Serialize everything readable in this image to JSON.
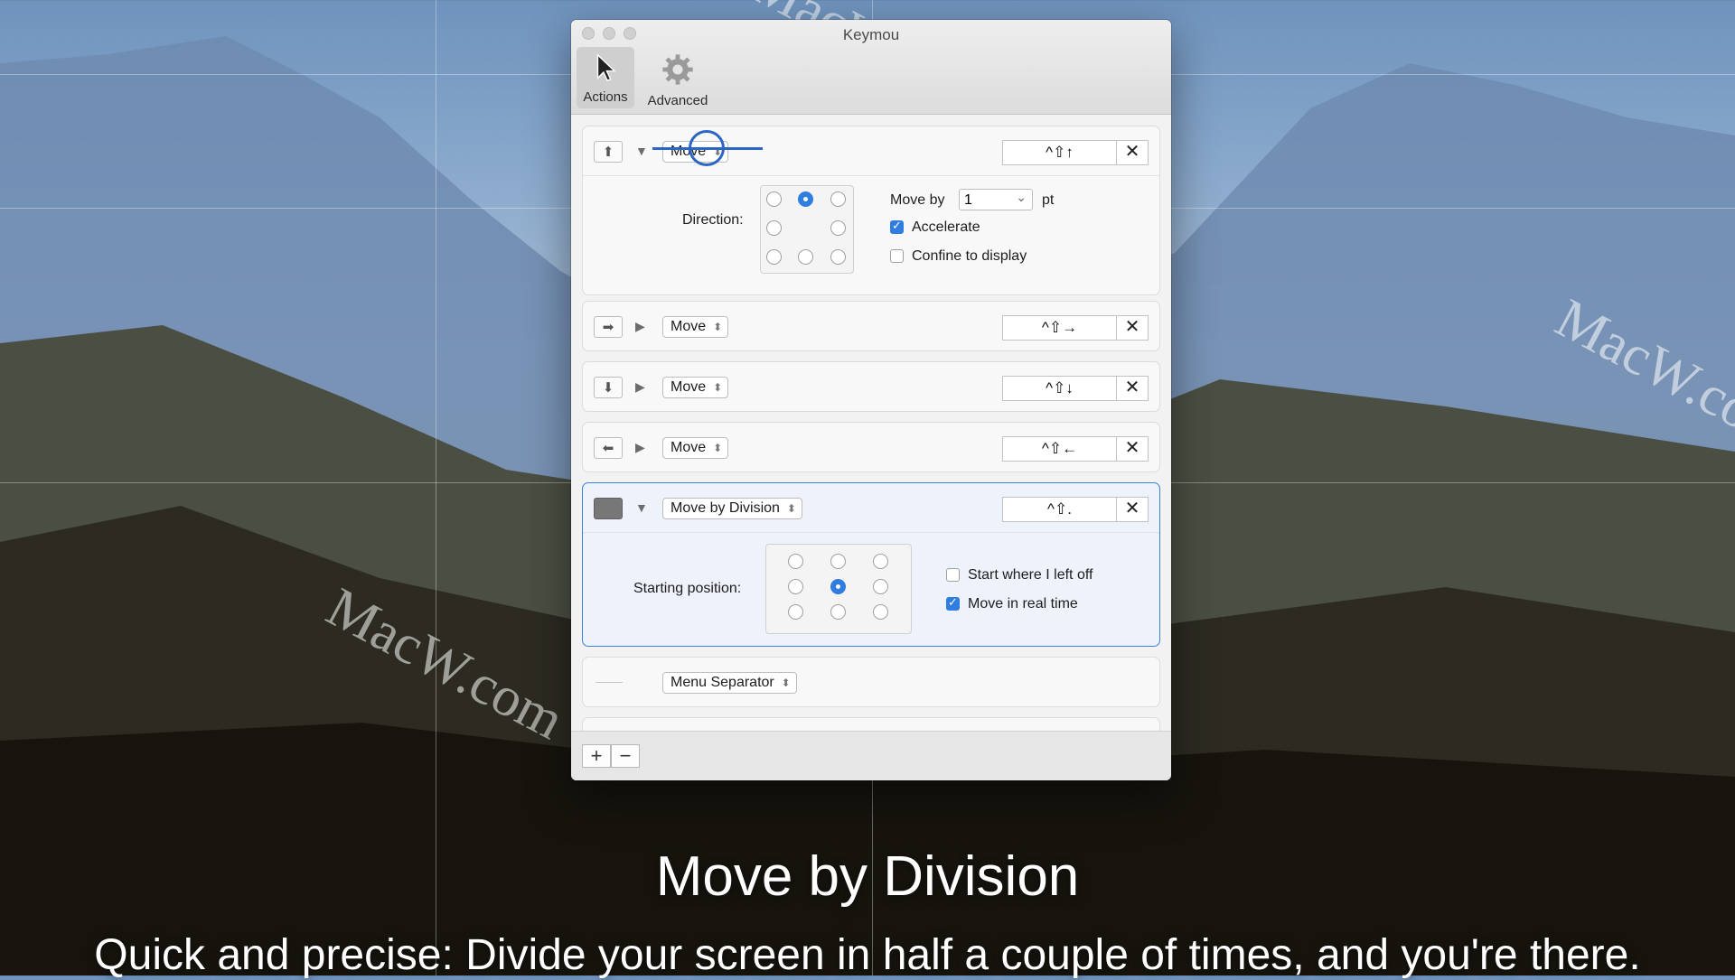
{
  "window": {
    "title": "Keymou",
    "toolbar": [
      {
        "label": "Actions",
        "icon": "cursor-arrow-icon",
        "active": true
      },
      {
        "label": "Advanced",
        "icon": "gear-icon",
        "active": false
      }
    ]
  },
  "rows": [
    {
      "icon": "arrow-up-icon",
      "action": "Move",
      "shortcut": "^⇧↑",
      "expanded": true
    },
    {
      "icon": "arrow-right-icon",
      "action": "Move",
      "shortcut": "^⇧→",
      "expanded": false
    },
    {
      "icon": "arrow-down-icon",
      "action": "Move",
      "shortcut": "^⇧↓",
      "expanded": false
    },
    {
      "icon": "arrow-left-icon",
      "action": "Move",
      "shortcut": "^⇧←",
      "expanded": false
    },
    {
      "icon": "division-icon",
      "action": "Move by Division",
      "shortcut": "^⇧.",
      "expanded": true,
      "selected": true
    },
    {
      "icon": "separator-icon",
      "action": "Menu Separator"
    }
  ],
  "move_detail": {
    "direction_label": "Direction:",
    "move_by_label": "Move by",
    "move_by_value": "1",
    "unit": "pt",
    "accelerate_label": "Accelerate",
    "accelerate_checked": true,
    "confine_label": "Confine to display",
    "confine_checked": false
  },
  "division_detail": {
    "starting_position_label": "Starting position:",
    "start_left_off_label": "Start where I left off",
    "start_left_off_checked": false,
    "real_time_label": "Move in real time",
    "real_time_checked": true
  },
  "bottom_bar": {
    "add": "+",
    "remove": "−"
  },
  "watermark": "MacW.com",
  "caption": {
    "title": "Move by Division",
    "subtitle": "Quick and precise: Divide your screen in half a couple of times, and you're there."
  },
  "colors": {
    "accent": "#2f7de1",
    "selection_border": "#3b82d6"
  }
}
